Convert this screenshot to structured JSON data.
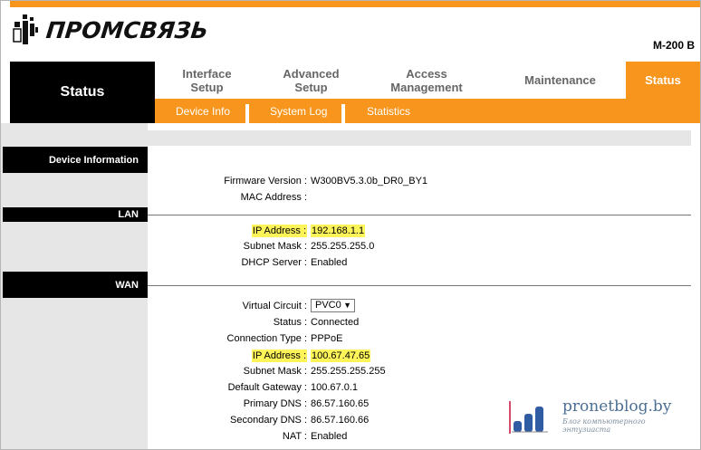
{
  "brand": {
    "logo_text": "ПРОМСВЯЗЬ",
    "model": "M-200 B"
  },
  "nav": {
    "section_title": "Status",
    "tabs": [
      {
        "label_line1": "Interface",
        "label_line2": "Setup"
      },
      {
        "label_line1": "Advanced",
        "label_line2": "Setup"
      },
      {
        "label_line1": "Access",
        "label_line2": "Management"
      },
      {
        "label_line1": "Maintenance",
        "label_line2": ""
      },
      {
        "label_line1": "Status",
        "label_line2": ""
      }
    ],
    "subnav": [
      "Device Info",
      "System Log",
      "Statistics"
    ]
  },
  "sections": {
    "device": "Device Information",
    "lan": "LAN",
    "wan": "WAN"
  },
  "device_info": {
    "firmware": {
      "label": "Firmware Version :",
      "value": "W300BV5.3.0b_DR0_BY1"
    },
    "mac": {
      "label": "MAC Address :",
      "value": ""
    }
  },
  "lan": {
    "ip": {
      "label": "IP Address :",
      "value": "192.168.1.1"
    },
    "mask": {
      "label": "Subnet Mask :",
      "value": "255.255.255.0"
    },
    "dhcp": {
      "label": "DHCP Server :",
      "value": "Enabled"
    }
  },
  "wan": {
    "vc": {
      "label": "Virtual Circuit :",
      "value": "PVC0"
    },
    "status": {
      "label": "Status :",
      "value": "Connected"
    },
    "conn_type": {
      "label": "Connection Type :",
      "value": "PPPoE"
    },
    "ip": {
      "label": "IP Address :",
      "value": "100.67.47.65"
    },
    "mask": {
      "label": "Subnet Mask :",
      "value": "255.255.255.255"
    },
    "gateway": {
      "label": "Default Gateway :",
      "value": "100.67.0.1"
    },
    "dns1": {
      "label": "Primary DNS :",
      "value": "86.57.160.65"
    },
    "dns2": {
      "label": "Secondary DNS :",
      "value": "86.57.160.66"
    },
    "nat": {
      "label": "NAT :",
      "value": "Enabled"
    }
  },
  "watermark": {
    "title": "pronetblog.by",
    "subtitle": "Блог компьютерного энтузиаста"
  },
  "colors": {
    "accent": "#f7951d",
    "highlight": "#fdf45a",
    "sidebar": "#e6e6e6"
  }
}
